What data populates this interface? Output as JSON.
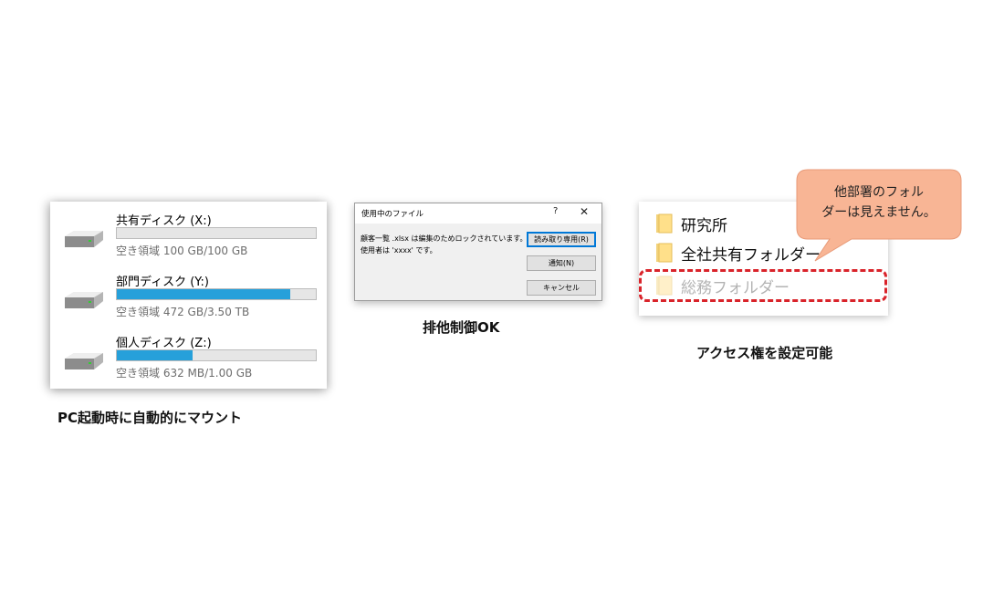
{
  "drives_panel": {
    "drives": [
      {
        "name": "共有ディスク (X:)",
        "free": "空き領域 100 GB/100 GB",
        "used_fraction": 0.0
      },
      {
        "name": "部門ディスク (Y:)",
        "free": "空き領域 472 GB/3.50 TB",
        "used_fraction": 0.87
      },
      {
        "name": "個人ディスク (Z:)",
        "free": "空き領域 632 MB/1.00 GB",
        "used_fraction": 0.38
      }
    ],
    "caption": "PC起動時に自動的にマウント",
    "bar_color": "#26a0da"
  },
  "dialog": {
    "title": "使用中のファイル",
    "help": "?",
    "close": "✕",
    "message_line1": "顧客一覧 .xlsx は編集のためロックされています。",
    "message_line2": "使用者は 'xxxx' です。",
    "buttons": {
      "read_only": "読み取り専用(R)",
      "notify": "通知(N)",
      "cancel": "キャンセル"
    },
    "caption": "排他制御OK"
  },
  "folders_panel": {
    "folders": [
      {
        "name": "研究所",
        "icon": "folder-icon"
      },
      {
        "name": "全社共有フォルダー",
        "icon": "folder-icon"
      },
      {
        "name": "総務フォルダー",
        "icon": "folder-icon"
      }
    ],
    "callout_line1": "他部署のフォル",
    "callout_line2": "ダーは見えません。",
    "callout_color": "#f8b595",
    "highlight_color": "#d9232a",
    "caption": "アクセス権を設定可能"
  }
}
